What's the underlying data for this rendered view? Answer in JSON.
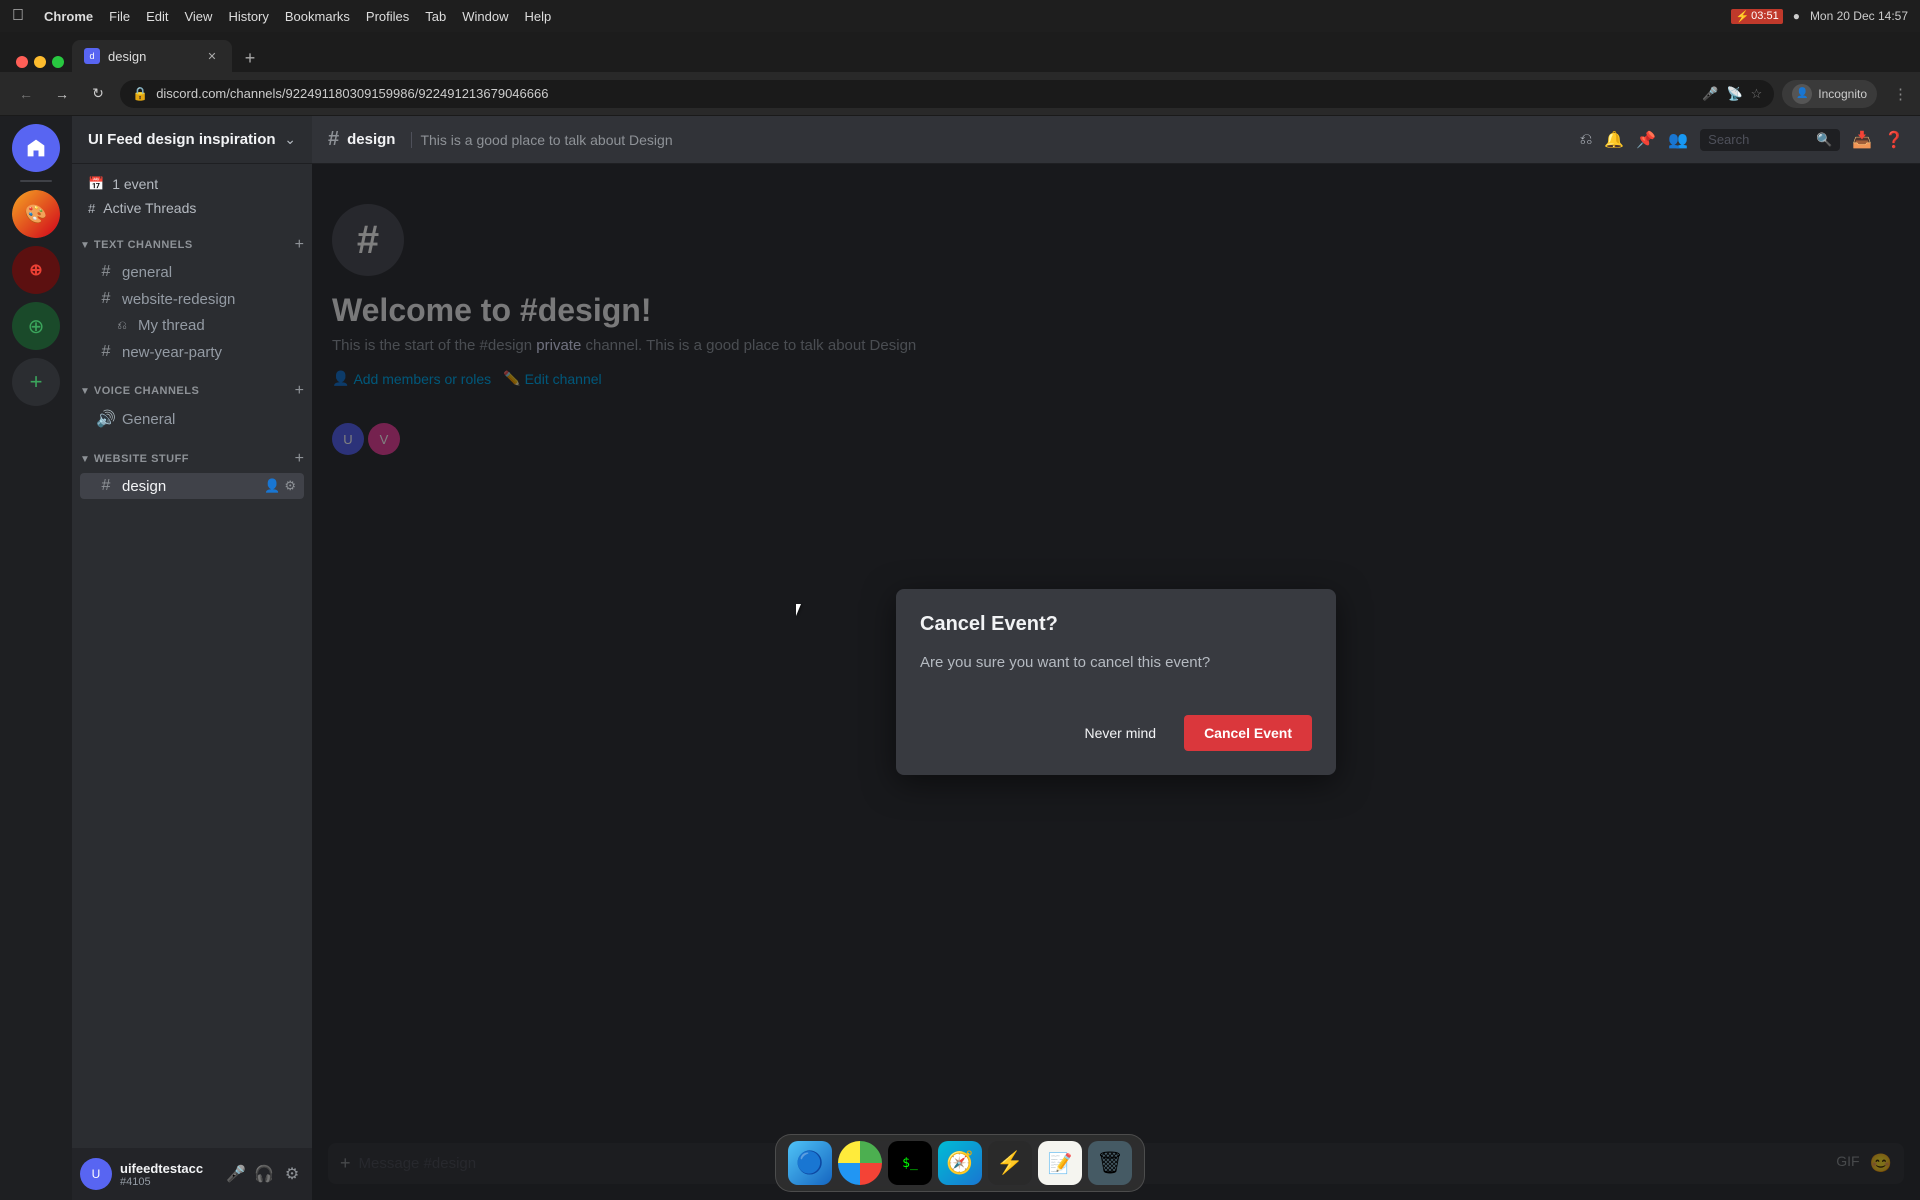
{
  "macos": {
    "menubar": {
      "apple": "⌘",
      "app_name": "Chrome",
      "menus": [
        "File",
        "Edit",
        "View",
        "History",
        "Bookmarks",
        "Profiles",
        "Tab",
        "Window",
        "Help"
      ],
      "time": "Mon 20 Dec  14:57",
      "battery_time": "03:51"
    },
    "dock": {
      "items": [
        {
          "name": "Finder",
          "icon": "🔵",
          "id": "finder"
        },
        {
          "name": "Chrome",
          "icon": "🌐",
          "id": "chrome"
        },
        {
          "name": "Terminal",
          "icon": ">_",
          "id": "terminal"
        },
        {
          "name": "Safari",
          "icon": "🧭",
          "id": "safari"
        },
        {
          "name": "Bolt",
          "icon": "⚡",
          "id": "bolt"
        },
        {
          "name": "Notes",
          "icon": "📝",
          "id": "notes"
        },
        {
          "name": "Trash",
          "icon": "🗑",
          "id": "trash"
        }
      ]
    }
  },
  "chrome": {
    "tab": {
      "title": "design",
      "favicon": "#"
    },
    "address": "discord.com/channels/922491180309159986/922491213679046666",
    "incognito_label": "Incognito"
  },
  "discord": {
    "server_name": "UI Feed design inspiration",
    "server_dropdown_icon": "▾",
    "sidebar": {
      "events": "1 event",
      "active_threads": "Active Threads",
      "text_channels_label": "TEXT CHANNELS",
      "channels": [
        {
          "name": "general",
          "icon": "#",
          "type": "text"
        },
        {
          "name": "website-redesign",
          "icon": "#",
          "type": "text"
        },
        {
          "name": "My thread",
          "icon": "",
          "type": "thread"
        },
        {
          "name": "new-year-party",
          "icon": "#",
          "type": "text"
        }
      ],
      "voice_channels_label": "VOICE CHANNELS",
      "voice_channels": [
        {
          "name": "General",
          "icon": "🔊",
          "type": "voice"
        }
      ],
      "website_stuff_label": "WEBSITE STUFF",
      "active_channel": "design"
    },
    "channel": {
      "name": "design",
      "icon": "#",
      "description": "This is a good place to talk about Design",
      "header_actions": [
        "threads",
        "notifications",
        "pin",
        "members",
        "search"
      ]
    },
    "welcome": {
      "title": "Welcome to #design!",
      "description": "This is the start of the #design private channel. This is a good place to talk about Design",
      "add_members": "Add members or roles",
      "edit_channel": "Edit channel"
    },
    "user": {
      "name": "uifeedtestacc",
      "tag": "#4105"
    },
    "message_placeholder": "Message #design"
  },
  "modal": {
    "title": "Cancel Event?",
    "body": "Are you sure you want to cancel this event?",
    "button_never_mind": "Never mind",
    "button_cancel_event": "Cancel Event"
  },
  "search": {
    "placeholder": "Search"
  }
}
